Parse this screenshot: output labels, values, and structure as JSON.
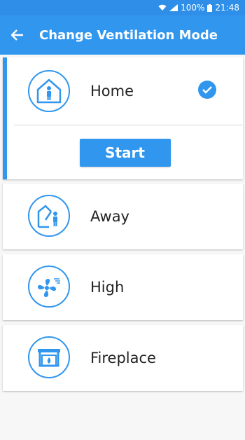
{
  "status_bar": {
    "signal": "100%",
    "time": "21:48"
  },
  "header": {
    "title": "Change Ventilation Mode"
  },
  "modes": [
    {
      "label": "Home",
      "icon": "home-person-icon",
      "selected": true,
      "action_label": "Start"
    },
    {
      "label": "Away",
      "icon": "away-person-icon",
      "selected": false
    },
    {
      "label": "High",
      "icon": "fan-icon",
      "selected": false
    },
    {
      "label": "Fireplace",
      "icon": "fireplace-icon",
      "selected": false
    }
  ],
  "colors": {
    "accent": "#3196ee",
    "background": "#f7f7f7"
  }
}
